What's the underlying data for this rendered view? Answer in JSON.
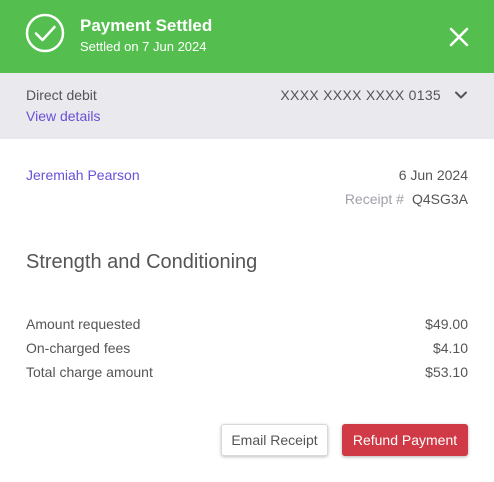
{
  "header": {
    "title": "Payment Settled",
    "subtitle": "Settled on 7 Jun 2024",
    "status_icon": "check-circle-icon",
    "close_icon": "close-icon",
    "color": "#54bf4f"
  },
  "payment_method": {
    "type": "Direct debit",
    "view_details_label": "View details",
    "masked_number": "XXXX XXXX XXXX 0135",
    "expand_icon": "chevron-down-icon"
  },
  "transaction": {
    "customer_name": "Jeremiah Pearson",
    "date": "6 Jun 2024",
    "receipt_label": "Receipt #",
    "receipt_number": "Q4SG3A",
    "service": "Strength and Conditioning"
  },
  "summary": [
    {
      "label": "Amount requested",
      "value": "$49.00"
    },
    {
      "label": "On-charged fees",
      "value": "$4.10"
    },
    {
      "label": "Total charge amount",
      "value": "$53.10"
    }
  ],
  "actions": {
    "email_label": "Email Receipt",
    "refund_label": "Refund Payment",
    "refund_color": "#d03a46"
  }
}
